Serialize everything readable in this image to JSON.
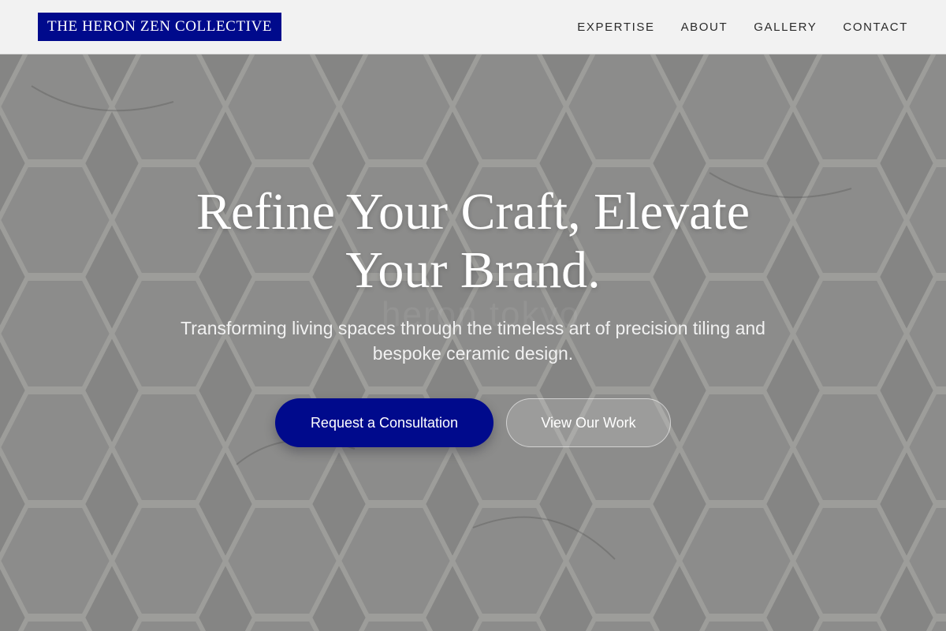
{
  "header": {
    "logo_text": "THE HERON ZEN COLLECTIVE",
    "nav": [
      {
        "label": "EXPERTISE"
      },
      {
        "label": "ABOUT"
      },
      {
        "label": "GALLERY"
      },
      {
        "label": "CONTACT"
      }
    ]
  },
  "hero": {
    "title_line1": "Refine Your Craft, Elevate",
    "title_line2": "Your Brand.",
    "subtitle_line1": "Transforming living spaces through the timeless art of precision tiling and",
    "subtitle_line2": "bespoke ceramic design.",
    "primary_button": "Request a Consultation",
    "secondary_button": "View Our Work",
    "watermark": "heron tokyo"
  },
  "colors": {
    "brand": "#000a8c",
    "header_bg": "#f2f2f2",
    "hero_bg": "#8c8c8a"
  }
}
